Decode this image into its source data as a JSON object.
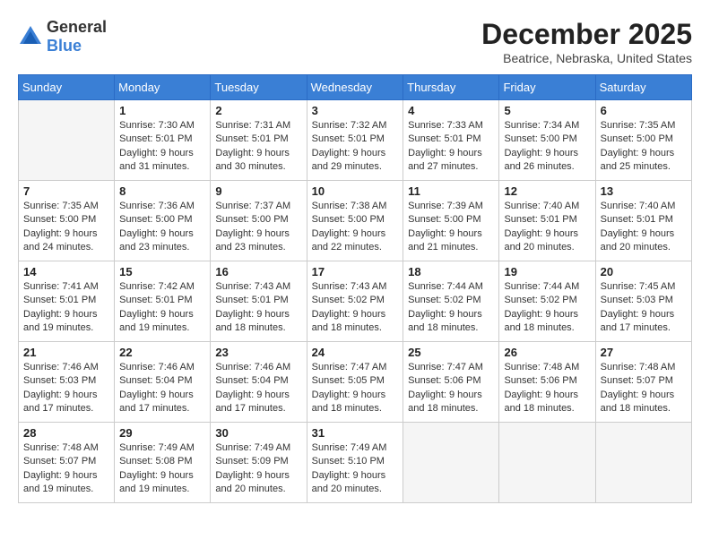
{
  "header": {
    "logo_general": "General",
    "logo_blue": "Blue",
    "month_title": "December 2025",
    "location": "Beatrice, Nebraska, United States"
  },
  "days_of_week": [
    "Sunday",
    "Monday",
    "Tuesday",
    "Wednesday",
    "Thursday",
    "Friday",
    "Saturday"
  ],
  "weeks": [
    [
      {
        "day": "",
        "empty": true
      },
      {
        "day": "1",
        "sunrise": "Sunrise: 7:30 AM",
        "sunset": "Sunset: 5:01 PM",
        "daylight": "Daylight: 9 hours and 31 minutes."
      },
      {
        "day": "2",
        "sunrise": "Sunrise: 7:31 AM",
        "sunset": "Sunset: 5:01 PM",
        "daylight": "Daylight: 9 hours and 30 minutes."
      },
      {
        "day": "3",
        "sunrise": "Sunrise: 7:32 AM",
        "sunset": "Sunset: 5:01 PM",
        "daylight": "Daylight: 9 hours and 29 minutes."
      },
      {
        "day": "4",
        "sunrise": "Sunrise: 7:33 AM",
        "sunset": "Sunset: 5:01 PM",
        "daylight": "Daylight: 9 hours and 27 minutes."
      },
      {
        "day": "5",
        "sunrise": "Sunrise: 7:34 AM",
        "sunset": "Sunset: 5:00 PM",
        "daylight": "Daylight: 9 hours and 26 minutes."
      },
      {
        "day": "6",
        "sunrise": "Sunrise: 7:35 AM",
        "sunset": "Sunset: 5:00 PM",
        "daylight": "Daylight: 9 hours and 25 minutes."
      }
    ],
    [
      {
        "day": "7",
        "sunrise": "Sunrise: 7:35 AM",
        "sunset": "Sunset: 5:00 PM",
        "daylight": "Daylight: 9 hours and 24 minutes."
      },
      {
        "day": "8",
        "sunrise": "Sunrise: 7:36 AM",
        "sunset": "Sunset: 5:00 PM",
        "daylight": "Daylight: 9 hours and 23 minutes."
      },
      {
        "day": "9",
        "sunrise": "Sunrise: 7:37 AM",
        "sunset": "Sunset: 5:00 PM",
        "daylight": "Daylight: 9 hours and 23 minutes."
      },
      {
        "day": "10",
        "sunrise": "Sunrise: 7:38 AM",
        "sunset": "Sunset: 5:00 PM",
        "daylight": "Daylight: 9 hours and 22 minutes."
      },
      {
        "day": "11",
        "sunrise": "Sunrise: 7:39 AM",
        "sunset": "Sunset: 5:00 PM",
        "daylight": "Daylight: 9 hours and 21 minutes."
      },
      {
        "day": "12",
        "sunrise": "Sunrise: 7:40 AM",
        "sunset": "Sunset: 5:01 PM",
        "daylight": "Daylight: 9 hours and 20 minutes."
      },
      {
        "day": "13",
        "sunrise": "Sunrise: 7:40 AM",
        "sunset": "Sunset: 5:01 PM",
        "daylight": "Daylight: 9 hours and 20 minutes."
      }
    ],
    [
      {
        "day": "14",
        "sunrise": "Sunrise: 7:41 AM",
        "sunset": "Sunset: 5:01 PM",
        "daylight": "Daylight: 9 hours and 19 minutes."
      },
      {
        "day": "15",
        "sunrise": "Sunrise: 7:42 AM",
        "sunset": "Sunset: 5:01 PM",
        "daylight": "Daylight: 9 hours and 19 minutes."
      },
      {
        "day": "16",
        "sunrise": "Sunrise: 7:43 AM",
        "sunset": "Sunset: 5:01 PM",
        "daylight": "Daylight: 9 hours and 18 minutes."
      },
      {
        "day": "17",
        "sunrise": "Sunrise: 7:43 AM",
        "sunset": "Sunset: 5:02 PM",
        "daylight": "Daylight: 9 hours and 18 minutes."
      },
      {
        "day": "18",
        "sunrise": "Sunrise: 7:44 AM",
        "sunset": "Sunset: 5:02 PM",
        "daylight": "Daylight: 9 hours and 18 minutes."
      },
      {
        "day": "19",
        "sunrise": "Sunrise: 7:44 AM",
        "sunset": "Sunset: 5:02 PM",
        "daylight": "Daylight: 9 hours and 18 minutes."
      },
      {
        "day": "20",
        "sunrise": "Sunrise: 7:45 AM",
        "sunset": "Sunset: 5:03 PM",
        "daylight": "Daylight: 9 hours and 17 minutes."
      }
    ],
    [
      {
        "day": "21",
        "sunrise": "Sunrise: 7:46 AM",
        "sunset": "Sunset: 5:03 PM",
        "daylight": "Daylight: 9 hours and 17 minutes."
      },
      {
        "day": "22",
        "sunrise": "Sunrise: 7:46 AM",
        "sunset": "Sunset: 5:04 PM",
        "daylight": "Daylight: 9 hours and 17 minutes."
      },
      {
        "day": "23",
        "sunrise": "Sunrise: 7:46 AM",
        "sunset": "Sunset: 5:04 PM",
        "daylight": "Daylight: 9 hours and 17 minutes."
      },
      {
        "day": "24",
        "sunrise": "Sunrise: 7:47 AM",
        "sunset": "Sunset: 5:05 PM",
        "daylight": "Daylight: 9 hours and 18 minutes."
      },
      {
        "day": "25",
        "sunrise": "Sunrise: 7:47 AM",
        "sunset": "Sunset: 5:06 PM",
        "daylight": "Daylight: 9 hours and 18 minutes."
      },
      {
        "day": "26",
        "sunrise": "Sunrise: 7:48 AM",
        "sunset": "Sunset: 5:06 PM",
        "daylight": "Daylight: 9 hours and 18 minutes."
      },
      {
        "day": "27",
        "sunrise": "Sunrise: 7:48 AM",
        "sunset": "Sunset: 5:07 PM",
        "daylight": "Daylight: 9 hours and 18 minutes."
      }
    ],
    [
      {
        "day": "28",
        "sunrise": "Sunrise: 7:48 AM",
        "sunset": "Sunset: 5:07 PM",
        "daylight": "Daylight: 9 hours and 19 minutes."
      },
      {
        "day": "29",
        "sunrise": "Sunrise: 7:49 AM",
        "sunset": "Sunset: 5:08 PM",
        "daylight": "Daylight: 9 hours and 19 minutes."
      },
      {
        "day": "30",
        "sunrise": "Sunrise: 7:49 AM",
        "sunset": "Sunset: 5:09 PM",
        "daylight": "Daylight: 9 hours and 20 minutes."
      },
      {
        "day": "31",
        "sunrise": "Sunrise: 7:49 AM",
        "sunset": "Sunset: 5:10 PM",
        "daylight": "Daylight: 9 hours and 20 minutes."
      },
      {
        "day": "",
        "empty": true
      },
      {
        "day": "",
        "empty": true
      },
      {
        "day": "",
        "empty": true
      }
    ]
  ]
}
